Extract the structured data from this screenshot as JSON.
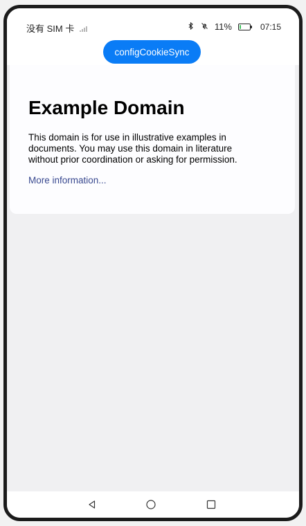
{
  "status_bar": {
    "carrier": "没有 SIM 卡",
    "battery_percent": "11%",
    "battery_level": 0.11,
    "time": "07:15",
    "icons": [
      "signal-icon",
      "bluetooth-icon",
      "mute-icon",
      "battery-icon"
    ]
  },
  "top_button": {
    "label": "configCookieSync"
  },
  "web_page": {
    "heading": "Example Domain",
    "body": "This domain is for use in illustrative examples in documents. You may use this domain in literature without prior coordination or asking for permission.",
    "link_text": "More information..."
  },
  "nav_bar": {
    "icons": [
      "back-icon",
      "home-icon",
      "recent-apps-icon"
    ]
  },
  "colors": {
    "accent": "#0a7cf6",
    "link": "#38488f",
    "page_bg": "#f0f0f2",
    "frame": "#1b1b1b"
  }
}
